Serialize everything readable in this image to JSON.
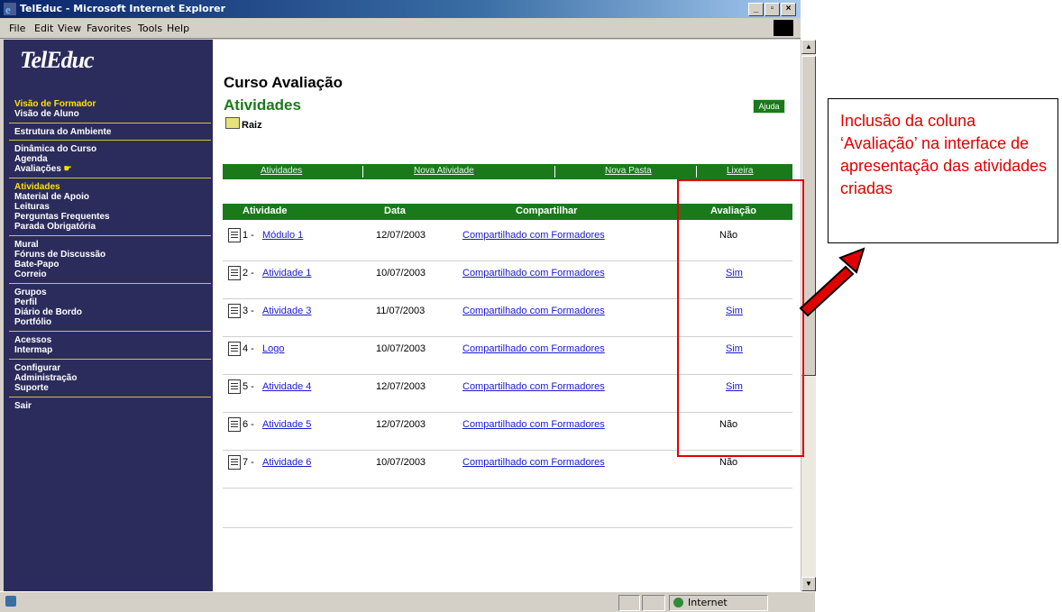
{
  "window": {
    "title": "TelEduc - Microsoft Internet Explorer"
  },
  "menu": [
    "File",
    "Edit",
    "View",
    "Favorites",
    "Tools",
    "Help"
  ],
  "sidebar": {
    "logo": "TelEduc",
    "groups": [
      {
        "items": [
          {
            "label": "Visão de Formador",
            "color": "#ffe000"
          },
          {
            "label": "Visão de Aluno",
            "color": "#ffffff"
          }
        ]
      },
      {
        "items": [
          {
            "label": "Estrutura do Ambiente",
            "color": "#ffffff"
          }
        ]
      },
      {
        "items": [
          {
            "label": "Dinâmica do Curso",
            "color": "#ffffff"
          },
          {
            "label": "Agenda",
            "color": "#ffffff"
          },
          {
            "label": "Avaliações",
            "color": "#ffffff"
          }
        ]
      },
      {
        "items": [
          {
            "label": "Atividades",
            "color": "#ffe000"
          },
          {
            "label": "Material de Apoio",
            "color": "#ffffff"
          },
          {
            "label": "Leituras",
            "color": "#ffffff"
          },
          {
            "label": "Perguntas Frequentes",
            "color": "#ffffff"
          },
          {
            "label": "Parada Obrigatória",
            "color": "#ffffff"
          }
        ]
      },
      {
        "items": [
          {
            "label": "Mural",
            "color": "#ffffff"
          },
          {
            "label": "Fóruns de Discussão",
            "color": "#ffffff"
          },
          {
            "label": "Bate-Papo",
            "color": "#ffffff"
          },
          {
            "label": "Correio",
            "color": "#ffffff"
          }
        ]
      },
      {
        "items": [
          {
            "label": "Grupos",
            "color": "#ffffff"
          },
          {
            "label": "Perfil",
            "color": "#ffffff"
          },
          {
            "label": "Diário de Bordo",
            "color": "#ffffff"
          },
          {
            "label": "Portfólio",
            "color": "#ffffff"
          }
        ]
      },
      {
        "items": [
          {
            "label": "Acessos",
            "color": "#ffffff"
          },
          {
            "label": "Intermap",
            "color": "#ffffff"
          }
        ]
      },
      {
        "items": [
          {
            "label": "Configurar",
            "color": "#ffffff"
          },
          {
            "label": "Administração",
            "color": "#ffffff"
          },
          {
            "label": "Suporte",
            "color": "#ffffff"
          }
        ]
      },
      {
        "items": [
          {
            "label": "Sair",
            "color": "#ffffff"
          }
        ]
      }
    ]
  },
  "main": {
    "course_title": "Curso Avaliação",
    "section_title": "Atividades",
    "help_label": "Ajuda",
    "breadcrumb": "Raiz",
    "tabs": [
      "Atividades",
      "Nova Atividade",
      "Nova Pasta",
      "Lixeira"
    ],
    "table": {
      "headers": [
        "Atividade",
        "Data",
        "Compartilhar",
        "Avaliação"
      ],
      "rows": [
        {
          "num": "1 -",
          "name": "Módulo 1",
          "date": "12/07/2003",
          "share": "Compartilhado com Formadores",
          "eval": "Não",
          "eval_link": false
        },
        {
          "num": "2 -",
          "name": "Atividade 1",
          "date": "10/07/2003",
          "share": "Compartilhado com Formadores",
          "eval": "Sim",
          "eval_link": true
        },
        {
          "num": "3 -",
          "name": "Atividade 3",
          "date": "11/07/2003",
          "share": "Compartilhado com Formadores",
          "eval": "Sim",
          "eval_link": true
        },
        {
          "num": "4 -",
          "name": "Logo",
          "date": "10/07/2003",
          "share": "Compartilhado com Formadores",
          "eval": "Sim",
          "eval_link": true
        },
        {
          "num": "5 -",
          "name": "Atividade 4",
          "date": "12/07/2003",
          "share": "Compartilhado com Formadores",
          "eval": "Sim",
          "eval_link": true
        },
        {
          "num": "6 -",
          "name": "Atividade 5",
          "date": "12/07/2003",
          "share": "Compartilhado com Formadores",
          "eval": "Não",
          "eval_link": false
        },
        {
          "num": "7 -",
          "name": "Atividade 6",
          "date": "10/07/2003",
          "share": "Compartilhado com Formadores",
          "eval": "Não",
          "eval_link": false
        }
      ]
    }
  },
  "status": {
    "zone": "Internet"
  },
  "annotation": {
    "text": "Inclusão da coluna ‘Avaliação’ na interface de apresentação das atividades criadas",
    "color": "#e00000"
  },
  "colors": {
    "sidebar_bg": "#2b2c5c",
    "green": "#1a7a1a",
    "link": "#1a1ad0"
  }
}
